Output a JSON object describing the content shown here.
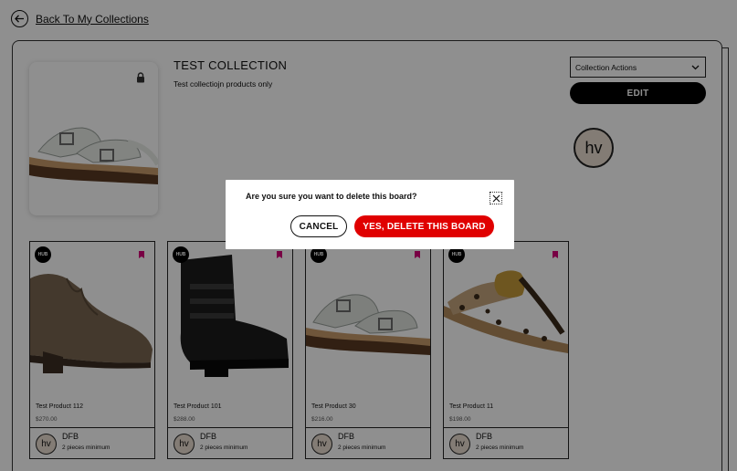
{
  "nav": {
    "back_label": "Back To My Collections"
  },
  "collection": {
    "title": "TEST COLLECTION",
    "description": "Test collectiojn products only",
    "actions_label": "Collection Actions",
    "edit_label": "EDIT",
    "vendor_logo": "hv"
  },
  "products": [
    {
      "badge": "HUB",
      "name": "Test Product 112",
      "price": "$270.00",
      "vendor_logo": "hv",
      "vendor": "DFB",
      "minimum": "2 pieces minimum"
    },
    {
      "badge": "HUB",
      "name": "Test Product 101",
      "price": "$288.00",
      "vendor_logo": "hv",
      "vendor": "DFB",
      "minimum": "2 pieces minimum"
    },
    {
      "badge": "HUB",
      "name": "Test Product 30",
      "price": "$216.00",
      "vendor_logo": "hv",
      "vendor": "DFB",
      "minimum": "2 pieces minimum"
    },
    {
      "badge": "HUB",
      "name": "Test Product 11",
      "price": "$198.00",
      "vendor_logo": "hv",
      "vendor": "DFB",
      "minimum": "2 pieces minimum"
    }
  ],
  "dialog": {
    "question": "Are you sure you want to delete this board?",
    "cancel_label": "CANCEL",
    "confirm_label": "YES, DELETE THIS BOARD"
  },
  "colors": {
    "accent": "#e00000",
    "save_icon": "#d6007a",
    "vendor_logo_bg": "#e9ddd0"
  },
  "icons": [
    "arrow-left-icon",
    "lock-icon",
    "chevron-down-icon",
    "bookmark-icon",
    "close-icon"
  ]
}
